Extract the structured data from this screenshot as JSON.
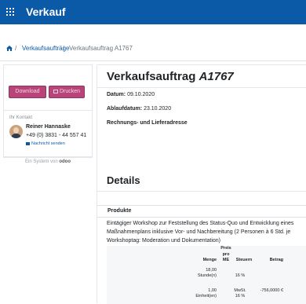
{
  "topbar": {
    "title": "Verkauf",
    "apps_icon": "grid-icon"
  },
  "breadcrumb": {
    "home_icon": "home-icon",
    "separator": "/",
    "parent": "Verkaufsaufträge",
    "current": "Verkaufsauftrag A1767"
  },
  "sidebar": {
    "download_label": "Download",
    "print_label": "Drucken",
    "contact_heading": "Ihr Kontakt",
    "contact_name": "Reiner Hannaske",
    "contact_phone": "+49 (0) 3831 - 44 557 41",
    "contact_message": "Nachricht senden",
    "powered_by_prefix": "Ein System von",
    "powered_by_brand": "odoo"
  },
  "document": {
    "title_prefix": "Verkaufsauftrag",
    "title_ref": "A1767",
    "date_label": "Datum:",
    "date_value": "09.10.2020",
    "expiry_label": "Ablaufdatum:",
    "expiry_value": "23.10.2020",
    "address_heading": "Rechnungs- und Lieferadresse"
  },
  "details": {
    "title": "Details",
    "products_header": "Produkte",
    "product_description": "Eintägiger Workshop zur Feststellung des Status-Quo und Entwicklung eines Maßnahmenplans inklusive Vor- und Nachbereitung (2 Personen à 6 Std. je Workshoptag: Moderation und Dokumentation)",
    "columns": {
      "quantity": "Menge",
      "price_line1": "Preis",
      "price_line2": "pro",
      "price_line3": "ME",
      "taxes": "Steuern",
      "amount": "Betrag"
    },
    "rows": [
      {
        "quantity": "18,00",
        "unit": "Stunde(n)",
        "price": "",
        "tax": "16 %",
        "tax2": "",
        "amount": ""
      },
      {
        "quantity": "1,00",
        "unit": "Einheit(en)",
        "price": "",
        "tax": "MwSt.",
        "tax2": "16 %",
        "amount": "-756,0000 €"
      }
    ]
  },
  "colors": {
    "navbar": "#0b5aa8",
    "button": "#b8447a",
    "link": "#0b5aa8"
  }
}
